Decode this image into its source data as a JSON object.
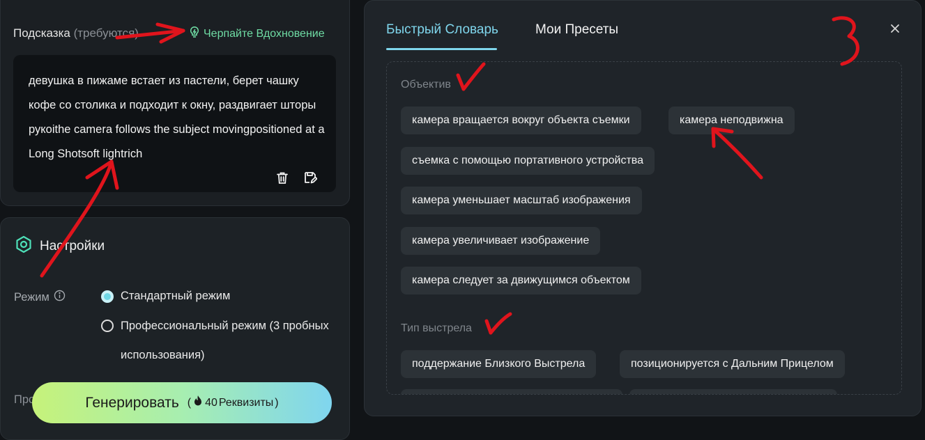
{
  "prompt": {
    "label": "Подсказка",
    "required_label": "(требуются)",
    "inspire_label": "Черпайте Вдохновение",
    "text": "девушка в пижаме встает из пастели, берет чашку кофе со столика и подходит к окну, раздвигает шторы рукоithe camera follows the subject movingpositioned at a Long Shotsoft lightrich",
    "delete_icon": "trash-icon",
    "save_icon": "save-icon"
  },
  "settings": {
    "title": "Настройки",
    "mode_label": "Режим",
    "mode_options": [
      {
        "label": "Стандартный режим",
        "selected": true
      },
      {
        "label": "Профессиональный режим (3 пробных использования)",
        "selected": false
      }
    ],
    "cut_label": "Про"
  },
  "generate": {
    "label": "Генерировать",
    "cost_open": "(",
    "cost": "40",
    "cost_unit": "Реквизиты",
    "cost_close": ")"
  },
  "panel": {
    "tabs": [
      {
        "label": "Быстрый Словарь",
        "active": true
      },
      {
        "label": "Мои Пресеты",
        "active": false
      }
    ],
    "sections": [
      {
        "title": "Объектив",
        "chips": [
          "камера вращается вокруг объекта съемки",
          "камера неподвижна",
          "съемка с помощью портативного устройства",
          "камера уменьшает масштаб изображения",
          "камера увеличивает изображение",
          "камера следует за движущимся объектом"
        ]
      },
      {
        "title": "Тип выстрела",
        "chips": [
          "поддержание Близкого Выстрела",
          "позиционируется с Дальним Прицелом"
        ]
      }
    ]
  },
  "annotations": {
    "number_label": "3",
    "color": "#e0141c"
  },
  "colors": {
    "accent": "#7fd6ec",
    "inspire": "#6fdca4",
    "background": "#111417",
    "panel": "#1f2429",
    "chip": "#2c3237"
  }
}
